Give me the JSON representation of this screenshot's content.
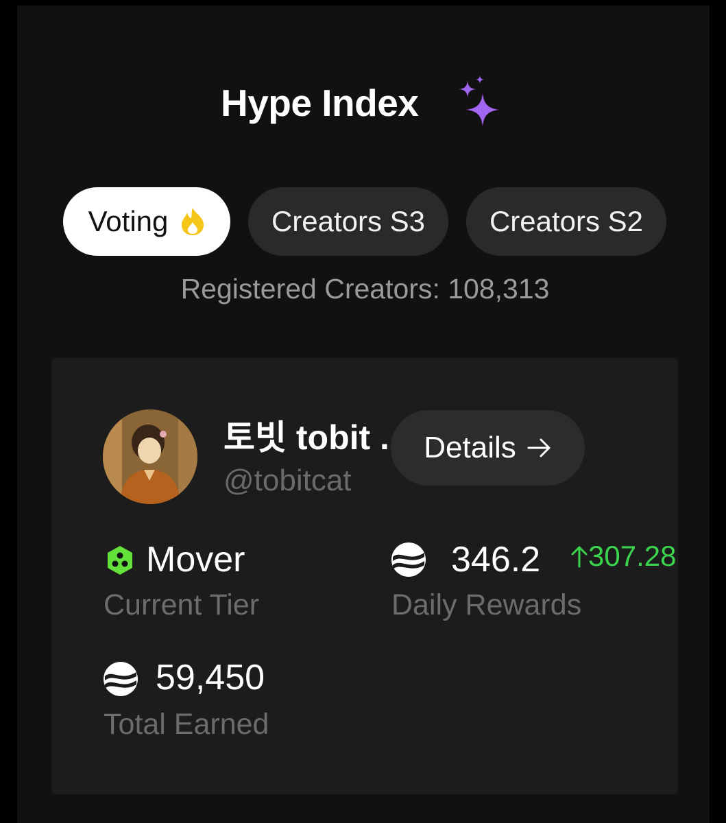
{
  "header": {
    "title": "Hype Index"
  },
  "tabs": [
    {
      "label": "Voting",
      "active": true
    },
    {
      "label": "Creators S3",
      "active": false
    },
    {
      "label": "Creators S2",
      "active": false
    }
  ],
  "registered_creators": "Registered Creators: 108,313",
  "creator": {
    "name": "토빗 tobit .",
    "handle": "@tobitcat",
    "details_label": "Details"
  },
  "stats": {
    "tier_value": "Mover",
    "tier_label": "Current Tier",
    "daily_value": "346.2",
    "daily_delta": "307.28",
    "daily_label": "Daily Rewards",
    "total_value": "59,450",
    "total_label": "Total Earned"
  },
  "colors": {
    "accent_purple": "#a066f2",
    "fire_yellow": "#f5c518",
    "tier_green": "#63e03a",
    "delta_green": "#3ad44d"
  },
  "icons": {
    "title": "sparkles-icon",
    "voting_tab": "fire-icon",
    "details": "arrow-right-icon",
    "tier": "hexagon-tier-icon",
    "rewards": "token-icon",
    "delta": "arrow-up-icon"
  }
}
